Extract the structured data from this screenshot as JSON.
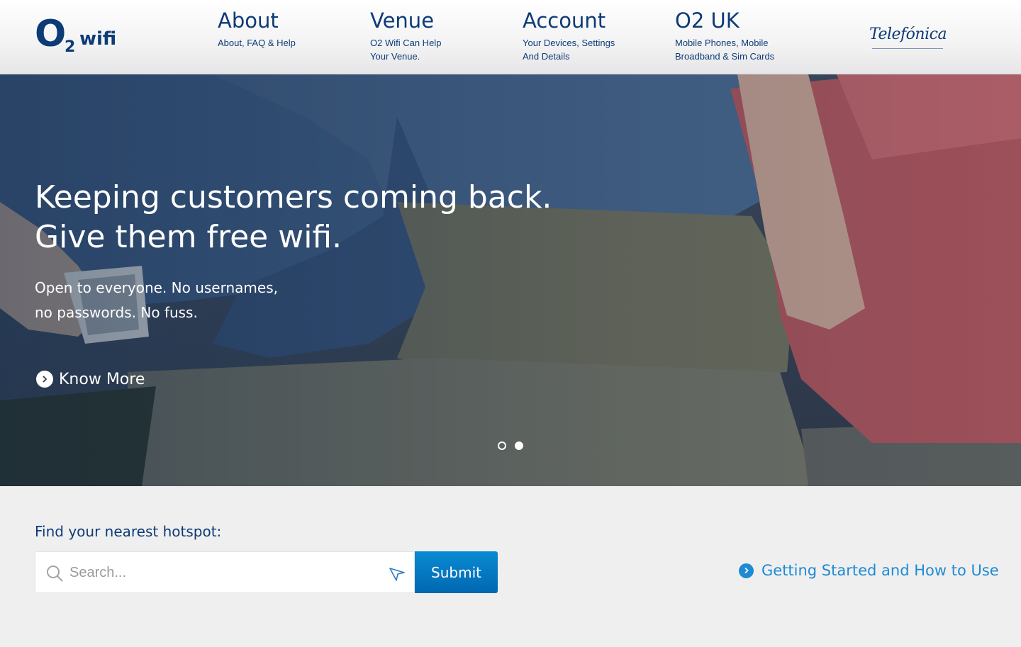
{
  "brand": {
    "logo_o": "O",
    "logo_2": "2",
    "logo_wifi": "wifi",
    "partner": "Telefónica"
  },
  "nav": [
    {
      "title": "About",
      "sub": "About, FAQ & Help"
    },
    {
      "title": "Venue",
      "sub_line1": "O2 Wifi Can Help",
      "sub_line2": "Your Venue."
    },
    {
      "title": "Account",
      "sub_line1": "Your Devices, Settings",
      "sub_line2": "And Details"
    },
    {
      "title": "O2 UK",
      "sub_line1": "Mobile Phones, Mobile",
      "sub_line2": "Broadband & Sim Cards"
    }
  ],
  "hero": {
    "headline_line1": "Keeping customers coming back.",
    "headline_line2": "Give them free wifi.",
    "body_line1": "Open to everyone. No usernames,",
    "body_line2": "no passwords. No fuss.",
    "cta": "Know More",
    "slides": 2,
    "active_slide": 2
  },
  "search": {
    "label": "Find your nearest hotspot:",
    "placeholder": "Search...",
    "value": "",
    "submit": "Submit"
  },
  "help_link": "Getting Started and How to Use",
  "colors": {
    "brand_navy": "#0d3b76",
    "accent_blue": "#0a7fc8",
    "link_blue": "#1e8bd2"
  },
  "icons": {
    "search": "search-icon",
    "location": "location-arrow-icon",
    "chevron": "chevron-right-icon"
  }
}
